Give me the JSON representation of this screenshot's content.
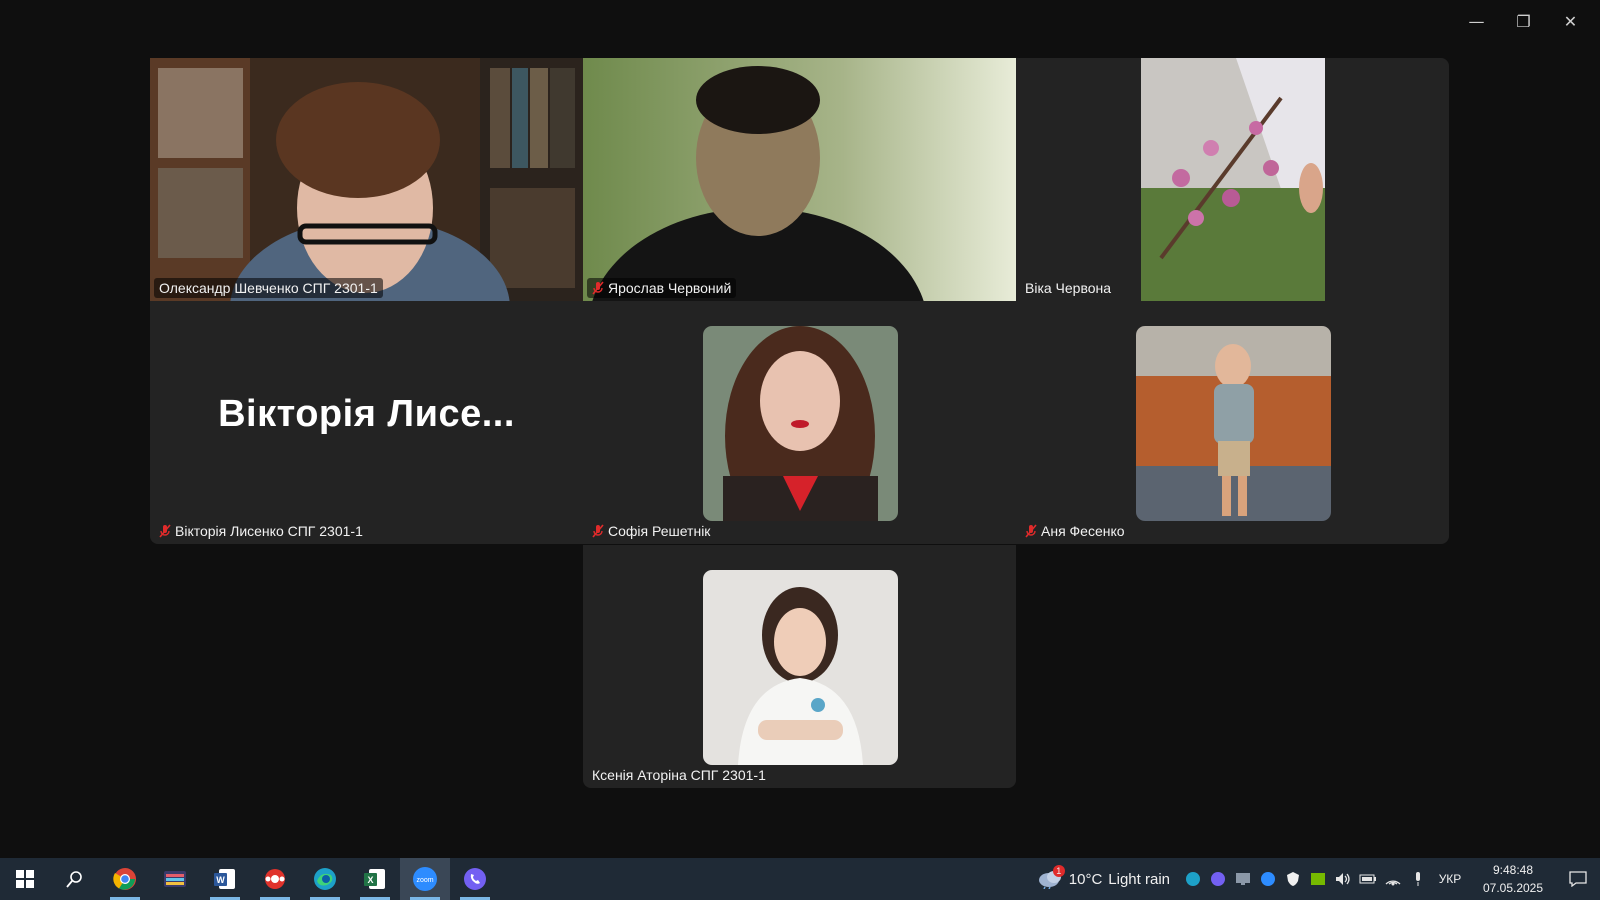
{
  "window_controls": {
    "minimize": "—",
    "restore": "❐",
    "close": "✕"
  },
  "participants": [
    {
      "name": "Олександр Шевченко СПГ 2301-1",
      "muted": false,
      "active_speaker": true
    },
    {
      "name": "Ярослав Червоний",
      "muted": true
    },
    {
      "name": "Віка Червона",
      "muted": false
    },
    {
      "name": "Вікторія Лисенко СПГ 2301-1",
      "muted": true,
      "display_text": "Вікторія Лисе..."
    },
    {
      "name": "Софія Решетнік",
      "muted": true
    },
    {
      "name": "Аня Фесенко",
      "muted": true
    },
    {
      "name": "Ксенія Аторіна СПГ 2301-1",
      "muted": false
    }
  ],
  "taskbar": {
    "apps": [
      "Windows Start",
      "Search",
      "Google Chrome",
      "Games",
      "Microsoft Word",
      "App",
      "Microsoft Edge",
      "Microsoft Excel",
      "Zoom",
      "Viber"
    ],
    "weather": {
      "temp": "10°C",
      "condition": "Light rain",
      "badge": "1"
    },
    "tray_icons": [
      "edge-icon",
      "viber-icon",
      "monitor-icon",
      "zoom-icon",
      "security-icon",
      "nvidia-icon",
      "volume-icon",
      "battery-icon",
      "wifi-icon",
      "mic-icon"
    ],
    "language": "УКР",
    "time": "9:48:48",
    "date": "07.05.2025"
  },
  "colors": {
    "active_speaker": "#23d96b",
    "muted_icon": "#e02b2b",
    "tile_bg": "#232323",
    "taskbar_bg": "#1f2a36"
  }
}
